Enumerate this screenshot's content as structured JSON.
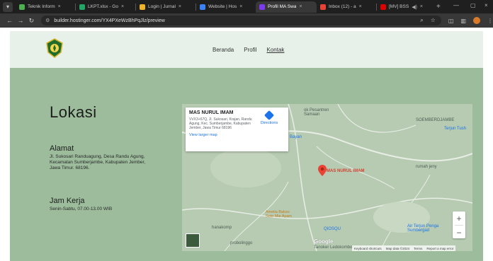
{
  "browser": {
    "tabs": [
      {
        "label": "Teknik Inform",
        "color": "#4caf50"
      },
      {
        "label": "LKPT.xlsx - Go",
        "color": "#22a565"
      },
      {
        "label": "Login | Jurnal",
        "color": "#f0b429"
      },
      {
        "label": "Website | Hos",
        "color": "#3b82f6"
      },
      {
        "label": "Profil MA Swa",
        "color": "#7c3aed",
        "active": true
      },
      {
        "label": "Inbox (12) - a",
        "color": "#ea4335"
      },
      {
        "label": "[MV] BSS",
        "color": "#e00000"
      }
    ],
    "url": "builder.hostinger.com/YX4PXeWzBhPqJlz/preview"
  },
  "header": {
    "nav": [
      "Beranda",
      "Profil",
      "Kontak"
    ],
    "active_nav": "Kontak"
  },
  "content": {
    "title": "Lokasi",
    "alamat_heading": "Alamat",
    "alamat_text": "Jl. Sukosari Randuagung, Desa Randu Agung, Kecamatan Sumberjambe, Kabupaten Jember, Jawa Timur. 68196.",
    "jam_heading": "Jam Kerja",
    "jam_text": "Senin-Sabtu, 07.00-13.00 WIB"
  },
  "map": {
    "place_name": "MAS NURUL IMAM",
    "place_address": "VVX3+67Q, Jl. Sukosari, Krajan, Randu Agung, Kec. Sumberjambe, Kabupaten Jember, Jawa Timur 68196",
    "directions_label": "Directions",
    "larger_map_label": "View larger map",
    "pin_label": "MAS NURUL IMAM",
    "labels": {
      "pesantren": "ok Pesantren\nSamaan",
      "sumberjambe": "SOEMBERDJAMBE",
      "terjun": "Terjun Tush",
      "bayan": "Bayan",
      "rumah": "rumah jeny",
      "amelia": "Amelia Bakso\nSoto Mie Ayam",
      "hanakomp": "hanakomp",
      "qiosqu": "QIOSQU",
      "air_terjun": "Air Terjun Penga\nSumbergad",
      "probolinggo": "probolinggo",
      "tanoker": "Tanoker Ledokombo"
    },
    "google": "Google",
    "attribution": [
      "Keyboard shortcuts",
      "Map data ©2024",
      "Terms",
      "Report a map error"
    ]
  }
}
